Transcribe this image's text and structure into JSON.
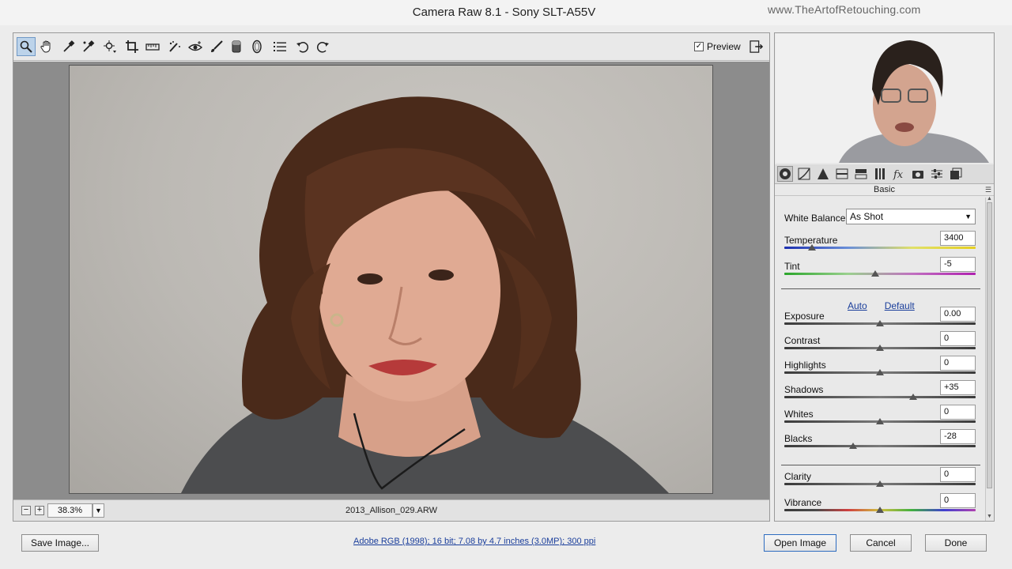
{
  "window": {
    "title": "Camera Raw 8.1  -  Sony SLT-A55V",
    "watermark": "www.TheArtofRetouching.com"
  },
  "toolbar": {
    "tools": [
      {
        "name": "zoom-tool",
        "icon": "magnifier-icon",
        "active": true
      },
      {
        "name": "hand-tool",
        "icon": "hand-icon"
      },
      {
        "name": "white-balance-tool",
        "icon": "eyedropper-icon"
      },
      {
        "name": "color-sampler-tool",
        "icon": "color-sampler-icon"
      },
      {
        "name": "targeted-adjustment-tool",
        "icon": "target-adjust-icon"
      },
      {
        "name": "crop-tool",
        "icon": "crop-icon"
      },
      {
        "name": "straighten-tool",
        "icon": "straighten-icon"
      },
      {
        "name": "spot-removal-tool",
        "icon": "spot-removal-icon"
      },
      {
        "name": "red-eye-tool",
        "icon": "red-eye-icon"
      },
      {
        "name": "adjustment-brush-tool",
        "icon": "brush-icon"
      },
      {
        "name": "graduated-filter-tool",
        "icon": "graduated-filter-icon"
      },
      {
        "name": "radial-filter-tool",
        "icon": "radial-filter-icon"
      },
      {
        "name": "preferences-tool",
        "icon": "list-icon"
      },
      {
        "name": "rotate-left-tool",
        "icon": "rotate-ccw-icon"
      },
      {
        "name": "rotate-right-tool",
        "icon": "rotate-cw-icon"
      }
    ],
    "preview_label": "Preview",
    "preview_checked": true
  },
  "status": {
    "zoom": "38.3%",
    "filename": "2013_Allison_029.ARW"
  },
  "panel": {
    "tabs": [
      {
        "name": "basic-tab",
        "icon": "aperture-icon",
        "active": true
      },
      {
        "name": "tone-curve-tab",
        "icon": "curve-icon"
      },
      {
        "name": "detail-tab",
        "icon": "triangle-icon"
      },
      {
        "name": "hsl-tab",
        "icon": "hsl-icon"
      },
      {
        "name": "split-toning-tab",
        "icon": "split-tone-icon"
      },
      {
        "name": "lens-corrections-tab",
        "icon": "lens-icon"
      },
      {
        "name": "effects-tab",
        "icon": "fx-icon"
      },
      {
        "name": "camera-calibration-tab",
        "icon": "camera-icon"
      },
      {
        "name": "presets-tab",
        "icon": "sliders-icon"
      },
      {
        "name": "snapshots-tab",
        "icon": "snapshots-icon"
      }
    ],
    "header": "Basic",
    "white_balance_label": "White Balance:",
    "white_balance_value": "As Shot",
    "temperature": {
      "label": "Temperature",
      "value": "3400"
    },
    "tint": {
      "label": "Tint",
      "value": "-5"
    },
    "auto_label": "Auto",
    "default_label": "Default",
    "sliders": [
      {
        "label": "Exposure",
        "value": "0.00",
        "pos": 0.5
      },
      {
        "label": "Contrast",
        "value": "0",
        "pos": 0.5
      },
      {
        "label": "Highlights",
        "value": "0",
        "pos": 0.5
      },
      {
        "label": "Shadows",
        "value": "+35",
        "pos": 0.675
      },
      {
        "label": "Whites",
        "value": "0",
        "pos": 0.5
      },
      {
        "label": "Blacks",
        "value": "-28",
        "pos": 0.36
      }
    ],
    "presence": [
      {
        "label": "Clarity",
        "value": "0",
        "pos": 0.5
      },
      {
        "label": "Vibrance",
        "value": "0",
        "pos": 0.5
      }
    ],
    "temperature_pos": 0.146,
    "tint_pos": 0.475
  },
  "footer": {
    "save_label": "Save Image...",
    "workflow_info": "Adobe RGB (1998); 16 bit; 7.08 by 4.7 inches (3.0MP); 300 ppi",
    "open_label": "Open Image",
    "cancel_label": "Cancel",
    "done_label": "Done"
  },
  "colors": {
    "accent": "#2d6cc0",
    "link": "#1a3e9b",
    "canvas_bg": "#8c8c8c"
  }
}
